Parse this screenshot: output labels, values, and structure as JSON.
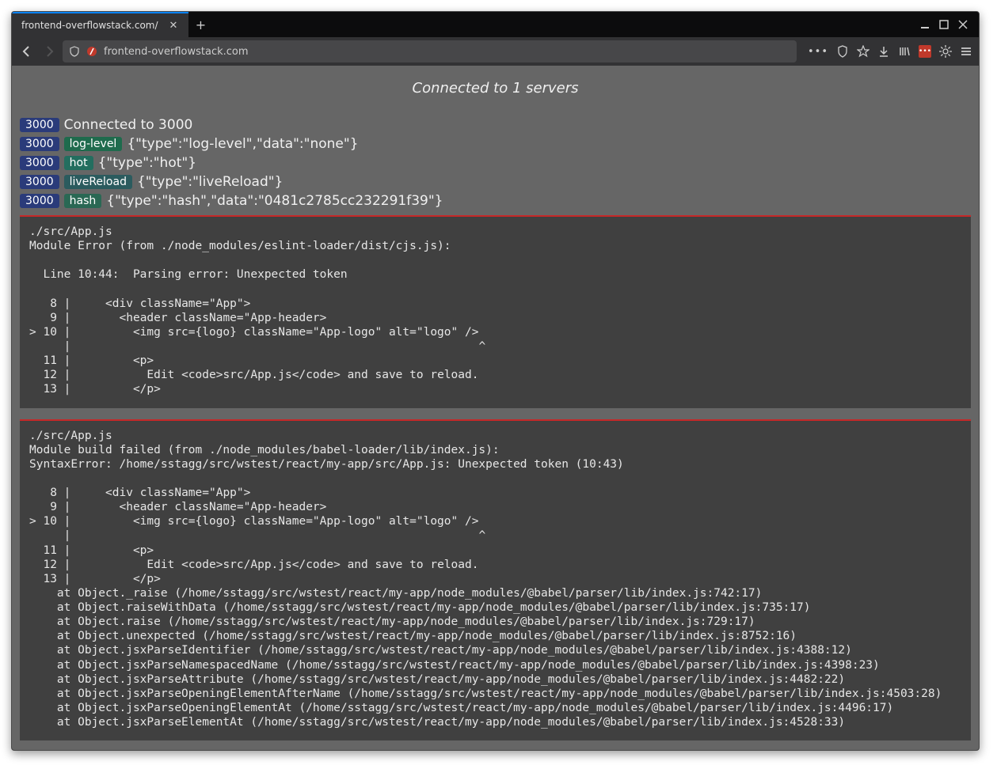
{
  "browser": {
    "tab_title": "frontend-overflowstack.com/",
    "url": "frontend-overflowstack.com"
  },
  "page": {
    "status_text": "Connected to 1 servers",
    "log_lines": [
      {
        "port": "3000",
        "badge": null,
        "badge_class": "",
        "message": "Connected to 3000"
      },
      {
        "port": "3000",
        "badge": "log-level",
        "badge_class": "loglevel",
        "message": "{\"type\":\"log-level\",\"data\":\"none\"}"
      },
      {
        "port": "3000",
        "badge": "hot",
        "badge_class": "hot",
        "message": "{\"type\":\"hot\"}"
      },
      {
        "port": "3000",
        "badge": "liveReload",
        "badge_class": "live",
        "message": "{\"type\":\"liveReload\"}"
      },
      {
        "port": "3000",
        "badge": "hash",
        "badge_class": "hash",
        "message": "{\"type\":\"hash\",\"data\":\"0481c2785cc232291f39\"}"
      }
    ],
    "error_blocks": [
      "./src/App.js\nModule Error (from ./node_modules/eslint-loader/dist/cjs.js):\n\n  Line 10:44:  Parsing error: Unexpected token\n\n   8 |     <div className=\"App\">\n   9 |       <header className=\"App-header>\n> 10 |         <img src={logo} className=\"App-logo\" alt=\"logo\" />\n     |                                                           ^\n  11 |         <p>\n  12 |           Edit <code>src/App.js</code> and save to reload.\n  13 |         </p>",
      "./src/App.js\nModule build failed (from ./node_modules/babel-loader/lib/index.js):\nSyntaxError: /home/sstagg/src/wstest/react/my-app/src/App.js: Unexpected token (10:43)\n\n   8 |     <div className=\"App\">\n   9 |       <header className=\"App-header>\n> 10 |         <img src={logo} className=\"App-logo\" alt=\"logo\" />\n     |                                                           ^\n  11 |         <p>\n  12 |           Edit <code>src/App.js</code> and save to reload.\n  13 |         </p>\n    at Object._raise (/home/sstagg/src/wstest/react/my-app/node_modules/@babel/parser/lib/index.js:742:17)\n    at Object.raiseWithData (/home/sstagg/src/wstest/react/my-app/node_modules/@babel/parser/lib/index.js:735:17)\n    at Object.raise (/home/sstagg/src/wstest/react/my-app/node_modules/@babel/parser/lib/index.js:729:17)\n    at Object.unexpected (/home/sstagg/src/wstest/react/my-app/node_modules/@babel/parser/lib/index.js:8752:16)\n    at Object.jsxParseIdentifier (/home/sstagg/src/wstest/react/my-app/node_modules/@babel/parser/lib/index.js:4388:12)\n    at Object.jsxParseNamespacedName (/home/sstagg/src/wstest/react/my-app/node_modules/@babel/parser/lib/index.js:4398:23)\n    at Object.jsxParseAttribute (/home/sstagg/src/wstest/react/my-app/node_modules/@babel/parser/lib/index.js:4482:22)\n    at Object.jsxParseOpeningElementAfterName (/home/sstagg/src/wstest/react/my-app/node_modules/@babel/parser/lib/index.js:4503:28)\n    at Object.jsxParseOpeningElementAt (/home/sstagg/src/wstest/react/my-app/node_modules/@babel/parser/lib/index.js:4496:17)\n    at Object.jsxParseElementAt (/home/sstagg/src/wstest/react/my-app/node_modules/@babel/parser/lib/index.js:4528:33)"
    ]
  }
}
